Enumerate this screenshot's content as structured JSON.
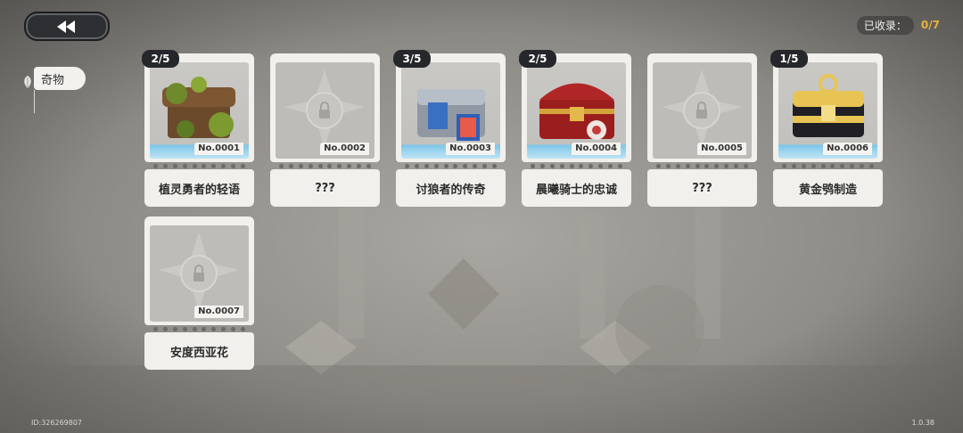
{
  "header": {
    "collected_label": "已收录：",
    "collected_value": "0/7"
  },
  "category_tab": {
    "label": "奇物"
  },
  "cards": [
    {
      "number": "No.0001",
      "name": "植灵勇者的轻语",
      "count": "2/5",
      "locked": false,
      "art": "vine-chest-icon"
    },
    {
      "number": "No.0002",
      "name": "???",
      "count": "",
      "locked": true,
      "art": "lock-icon"
    },
    {
      "number": "No.0003",
      "name": "讨狼者的传奇",
      "count": "3/5",
      "locked": false,
      "art": "steel-chest-icon"
    },
    {
      "number": "No.0004",
      "name": "晨曦骑士的忠诚",
      "count": "2/5",
      "locked": false,
      "art": "red-chest-icon"
    },
    {
      "number": "No.0005",
      "name": "???",
      "count": "",
      "locked": true,
      "art": "lock-icon"
    },
    {
      "number": "No.0006",
      "name": "黄金鸮制造",
      "count": "1/5",
      "locked": false,
      "art": "gold-chest-icon"
    },
    {
      "number": "No.0007",
      "name": "安度西亚花",
      "count": "",
      "locked": true,
      "art": "lock-icon"
    }
  ],
  "footer": {
    "id": "ID:326269807",
    "version": "1.0.38"
  },
  "colors": {
    "accent": "#e9b23d",
    "badge": "#26272b",
    "card": "#f1f0ec"
  }
}
